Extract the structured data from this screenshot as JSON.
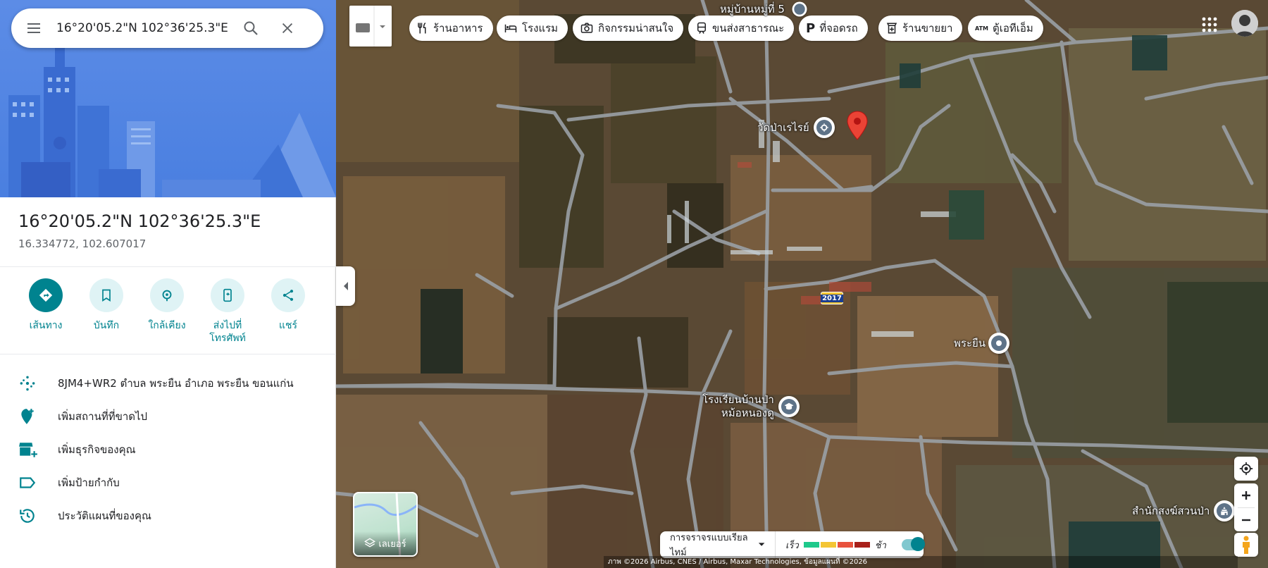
{
  "search": {
    "value": "16°20'05.2\"N 102°36'25.3\"E"
  },
  "place": {
    "title": "16°20'05.2\"N 102°36'25.3\"E",
    "coords": "16.334772, 102.607017"
  },
  "actions": [
    {
      "label": "เส้นทาง",
      "icon": "directions-icon"
    },
    {
      "label": "บันทึก",
      "icon": "bookmark-icon"
    },
    {
      "label": "ใกล้เคียง",
      "icon": "nearby-icon"
    },
    {
      "label": "ส่งไปที่\nโทรศัพท์",
      "icon": "send-to-phone-icon"
    },
    {
      "label": "แชร์",
      "icon": "share-icon"
    }
  ],
  "details": [
    {
      "text": "8JM4+WR2 ตำบล พระยืน อำเภอ พระยืน ขอนแก่น",
      "icon": "plus-code-icon"
    },
    {
      "text": "เพิ่มสถานที่ที่ขาดไป",
      "icon": "add-place-icon"
    },
    {
      "text": "เพิ่มธุรกิจของคุณ",
      "icon": "add-business-icon"
    },
    {
      "text": "เพิ่มป้ายกำกับ",
      "icon": "label-icon"
    },
    {
      "text": "ประวัติแผนที่ของคุณ",
      "icon": "history-icon"
    }
  ],
  "chips": [
    {
      "label": "ร้านอาหาร",
      "icon": "restaurant-icon"
    },
    {
      "label": "โรงแรม",
      "icon": "hotel-icon"
    },
    {
      "label": "กิจกรรมน่าสนใจ",
      "icon": "camera-icon"
    },
    {
      "label": "ขนส่งสาธารณะ",
      "icon": "transit-icon"
    },
    {
      "label": "ที่จอดรถ",
      "icon": "parking-icon"
    },
    {
      "label": "ร้านขายยา",
      "icon": "pharmacy-icon"
    },
    {
      "label": "ตู้เอทีเอ็ม",
      "icon": "atm-icon"
    }
  ],
  "map_labels": {
    "village": "หมู่บ้านหมู่ที่ 5",
    "temple": "วัดป่าเรไรย์",
    "phrayuen": "พระยืน",
    "school_line1": "โรงเรียนบ้านป่า",
    "school_line2": "หม้อหนองดู",
    "monastery": "สำนักสงฆ์สวนป่า",
    "route": "2017"
  },
  "layers_label": "เลเยอร์",
  "traffic": {
    "mode": "การจราจรแบบเรียลไทม์",
    "fast": "เร็ว",
    "slow": "ช้า",
    "colors": [
      "#1ec98b",
      "#f4c534",
      "#e8523d",
      "#a8201a"
    ]
  },
  "attribution": "ภาพ ©2026 Airbus, CNES / Airbus, Maxar Technologies, ข้อมูลแผนที่ ©2026"
}
